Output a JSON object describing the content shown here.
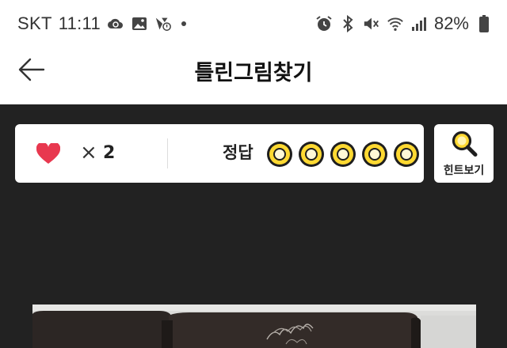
{
  "status_bar": {
    "carrier": "SKT",
    "time": "11:11",
    "battery": "82%",
    "icons_left": [
      "cloud-sync-icon",
      "gallery-icon",
      "navigation-icon",
      "notification-dot"
    ],
    "icons_right": [
      "alarm-icon",
      "bluetooth-icon",
      "mute-icon",
      "wifi-icon",
      "signal-icon",
      "battery-icon"
    ]
  },
  "app_bar": {
    "title": "틀린그림찾기",
    "back_icon": "arrow-left-icon"
  },
  "status_card": {
    "lives_times": "×",
    "lives_count": "2",
    "answer_label": "정답",
    "answers_found": 0,
    "answers_total": 5
  },
  "hint_button": {
    "label": "힌트보기",
    "icon": "magnifier-icon"
  },
  "colors": {
    "accent_yellow": "#ffd932",
    "heart_red": "#e8384f",
    "board_bg": "#222222"
  }
}
